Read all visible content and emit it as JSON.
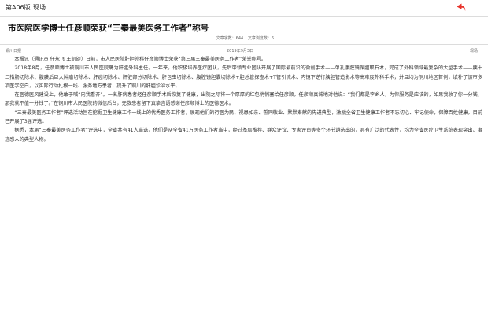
{
  "header": {
    "section_code": "第A06版",
    "section_name": "现场",
    "back_icon": "back-arrow-icon",
    "accent_color": "#e8332b"
  },
  "article": {
    "title": "市医院医学博士任彦顺荣获“三秦最美医务工作者”称号",
    "word_count_label": "文章字数：644",
    "views_label": "文章浏览数：6",
    "source": "铜川日报",
    "date": "2019年9月3日",
    "column": "现场",
    "paragraphs": [
      "本报讯（通讯员 任永飞 王凯旋）日前，市人民医院肝胆外科任彦顺博士荣获“第三届三秦最美医务工作者”荣誉称号。",
      "2018年8月，任彦顺博士被铜川市人民医院聘为肝胆外科主任。一年来，他积极培养医疗团队，先后带领专业团队开展了国际最前沿的微创手术——单孔腹腔镜保胆取石术，完成了外科领域最复杂的大型手术——胰十二指肠切除术、腹膜后巨大肿瘤切除术、肝癌切除术、肝脏部分切除术、肝包虫切除术、腹腔镜胆囊切除术+胆总管探查术+T管引流术、内镜下逆行胰胆管造影术等高难度外科手术，并且均为铜川地区首例，填补了该市多项医学空白，以实际行动扎根一线、服务地方患者，提升了铜川的肝胆诊治水平。",
      "在医德医风建设上，他敢于喊“向我看齐”。一名肝病患者经任彦顺手术后恢复了健康，出院之际将一个厚厚的红包悄悄塞给任彦顺，任彦顺真诚地对他说：“我们都是李乡人，为你服务是应该的，如果我收了你一分钱，那我就不值一分钱了。”在铜川市人民医院的微信后台，无数患者留下真挚言语感谢任彦顺博士的医德医术。",
      "“三秦最美医务工作者”评选活动旨在挖掘卫生健康工作一线上的优秀医务工作者，展现他们的行医为民、视患如亲、誓同敬业、默默奉献的先进典型，激励全省卫生健康工作者不忘初心、牢记使命，保障百姓健康，目前已开展了3届评选。",
      "据悉，本届“三秦最美医务工作者”评选中，全省共有41人当选，他们是从全省41万医务工作者当中，经过基层推荐、群众评议、专家评审等多个环节遴选出的，具有广泛的代表性，均为全省医疗卫生系统表现突出、事迹感人的典型人物。"
    ]
  }
}
